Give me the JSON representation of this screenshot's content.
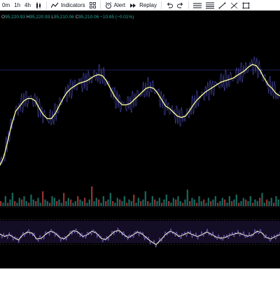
{
  "toolbar": {
    "timeframes": [
      "0m",
      "1h",
      "4h"
    ],
    "indicators_label": "Indicators",
    "alert_label": "Alert",
    "replay_label": "Replay"
  },
  "legend": {
    "o_key": "O",
    "o_val": "95,220.93",
    "h_key": "H",
    "h_val": "95,220.93",
    "l_key": "L",
    "l_val": "95,210.06",
    "c_key": "C",
    "c_val": "95,210.06",
    "change": "−10.85 (−0.01%)"
  },
  "colors": {
    "background": "#000000",
    "price_raw": "#5a5ad8",
    "price_smoothed": "#ffff99",
    "volume_up": "#26a69a",
    "volume_down": "#ef5350",
    "oscillator": "#7b6cd9",
    "oscillator_signal": "#ffffcc",
    "band_fill": "#1a1030",
    "level_line": "#3a3a8a"
  },
  "chart_data": {
    "type": "line",
    "series": [
      {
        "values": [
          0.05,
          0.12,
          0.25,
          0.38,
          0.48,
          0.52,
          0.56,
          0.58,
          0.58,
          0.56,
          0.5,
          0.45,
          0.42,
          0.42,
          0.46,
          0.52,
          0.58,
          0.63,
          0.66,
          0.68,
          0.7,
          0.71,
          0.72,
          0.74,
          0.76,
          0.77,
          0.76,
          0.72,
          0.66,
          0.6,
          0.56,
          0.53,
          0.53,
          0.54,
          0.57,
          0.6,
          0.63,
          0.66,
          0.67,
          0.66,
          0.62,
          0.57,
          0.52,
          0.5,
          0.47,
          0.44,
          0.43,
          0.44,
          0.48,
          0.53,
          0.57,
          0.6,
          0.63,
          0.65,
          0.67,
          0.69,
          0.71,
          0.72,
          0.73,
          0.74,
          0.76,
          0.78,
          0.8,
          0.83,
          0.85,
          0.84,
          0.8,
          0.74,
          0.69,
          0.66,
          0.62,
          0.6
        ]
      },
      {
        "values": [
          0.52,
          0.45,
          0.5,
          0.42,
          0.35,
          0.5,
          0.58,
          0.55,
          0.38,
          0.4,
          0.52,
          0.6,
          0.55,
          0.42,
          0.38,
          0.5,
          0.62,
          0.58,
          0.45,
          0.5,
          0.6,
          0.55,
          0.4,
          0.36,
          0.48,
          0.6,
          0.62,
          0.5,
          0.42,
          0.5,
          0.58,
          0.52,
          0.4,
          0.3,
          0.22,
          0.35,
          0.5,
          0.6,
          0.55,
          0.45,
          0.5,
          0.56,
          0.5,
          0.45,
          0.5,
          0.58,
          0.52,
          0.44,
          0.4,
          0.42,
          0.48,
          0.52,
          0.55,
          0.5,
          0.46,
          0.5,
          0.6,
          0.56,
          0.42,
          0.38,
          0.45,
          0.5
        ]
      }
    ],
    "volume": {
      "values": [
        3,
        2,
        6,
        2,
        4,
        8,
        3,
        2,
        5,
        4,
        6,
        3,
        2,
        7,
        4,
        3,
        5,
        2,
        9,
        4,
        3,
        2,
        6,
        5,
        3,
        4,
        2,
        8,
        3,
        5,
        4,
        2,
        3,
        6,
        4,
        3,
        5,
        2,
        4,
        12,
        3,
        5,
        4,
        2,
        6,
        3,
        4,
        8,
        3,
        2,
        5,
        4,
        3,
        6,
        2,
        4,
        3,
        7,
        2,
        5,
        3,
        4,
        9,
        3,
        2,
        6,
        4,
        3,
        5,
        2,
        4,
        7,
        3,
        2,
        5,
        4,
        6,
        3,
        2,
        4,
        10,
        3,
        5,
        4,
        2,
        6,
        3,
        4,
        2,
        5,
        3,
        4,
        6,
        2,
        3,
        5,
        4,
        2,
        6,
        3,
        4,
        7,
        2,
        3,
        5,
        4,
        3,
        6,
        2,
        4,
        3,
        5,
        8,
        2,
        4,
        3,
        5,
        2,
        6,
        4
      ]
    },
    "grid": false
  }
}
